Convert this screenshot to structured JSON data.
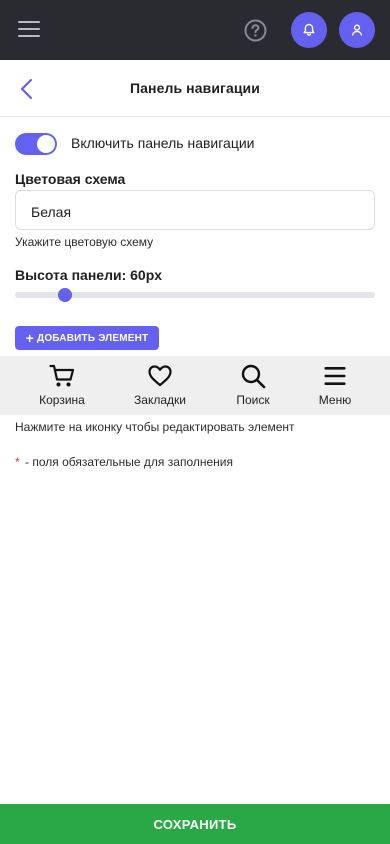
{
  "app_bar": {
    "icons": [
      "hamburger-icon",
      "help-icon",
      "bell-icon",
      "user-icon"
    ],
    "accent_color": "#6561f0",
    "background_color": "#2a2a31"
  },
  "header": {
    "title": "Панель навигации",
    "back_icon": "chevron-left-icon"
  },
  "toggle": {
    "label": "Включить панель навигации",
    "enabled": true
  },
  "color_scheme": {
    "label": "Цветовая схема",
    "value": "Белая",
    "hint": "Укажите цветовую схему"
  },
  "panel_height": {
    "label": "Высота панели: 60px",
    "value": 60,
    "slider_fraction": 0.14
  },
  "add_button": {
    "plus": "+",
    "label": "ДОБАВИТЬ ЭЛЕМЕНТ"
  },
  "nav_preview": {
    "items": [
      {
        "label": "Корзина",
        "icon": "cart-icon"
      },
      {
        "label": "Закладки",
        "icon": "heart-icon"
      },
      {
        "label": "Поиск",
        "icon": "search-icon"
      },
      {
        "label": "Меню",
        "icon": "menu-icon"
      }
    ]
  },
  "nav_hint": "Нажмите на иконку чтобы редактировать элемент",
  "required_note": {
    "star": "*",
    "text": "- поля обязательные для заполнения",
    "star_color": "#e0333b"
  },
  "save_button": {
    "label": "СОХРАНИТЬ",
    "color": "#2aa845"
  }
}
